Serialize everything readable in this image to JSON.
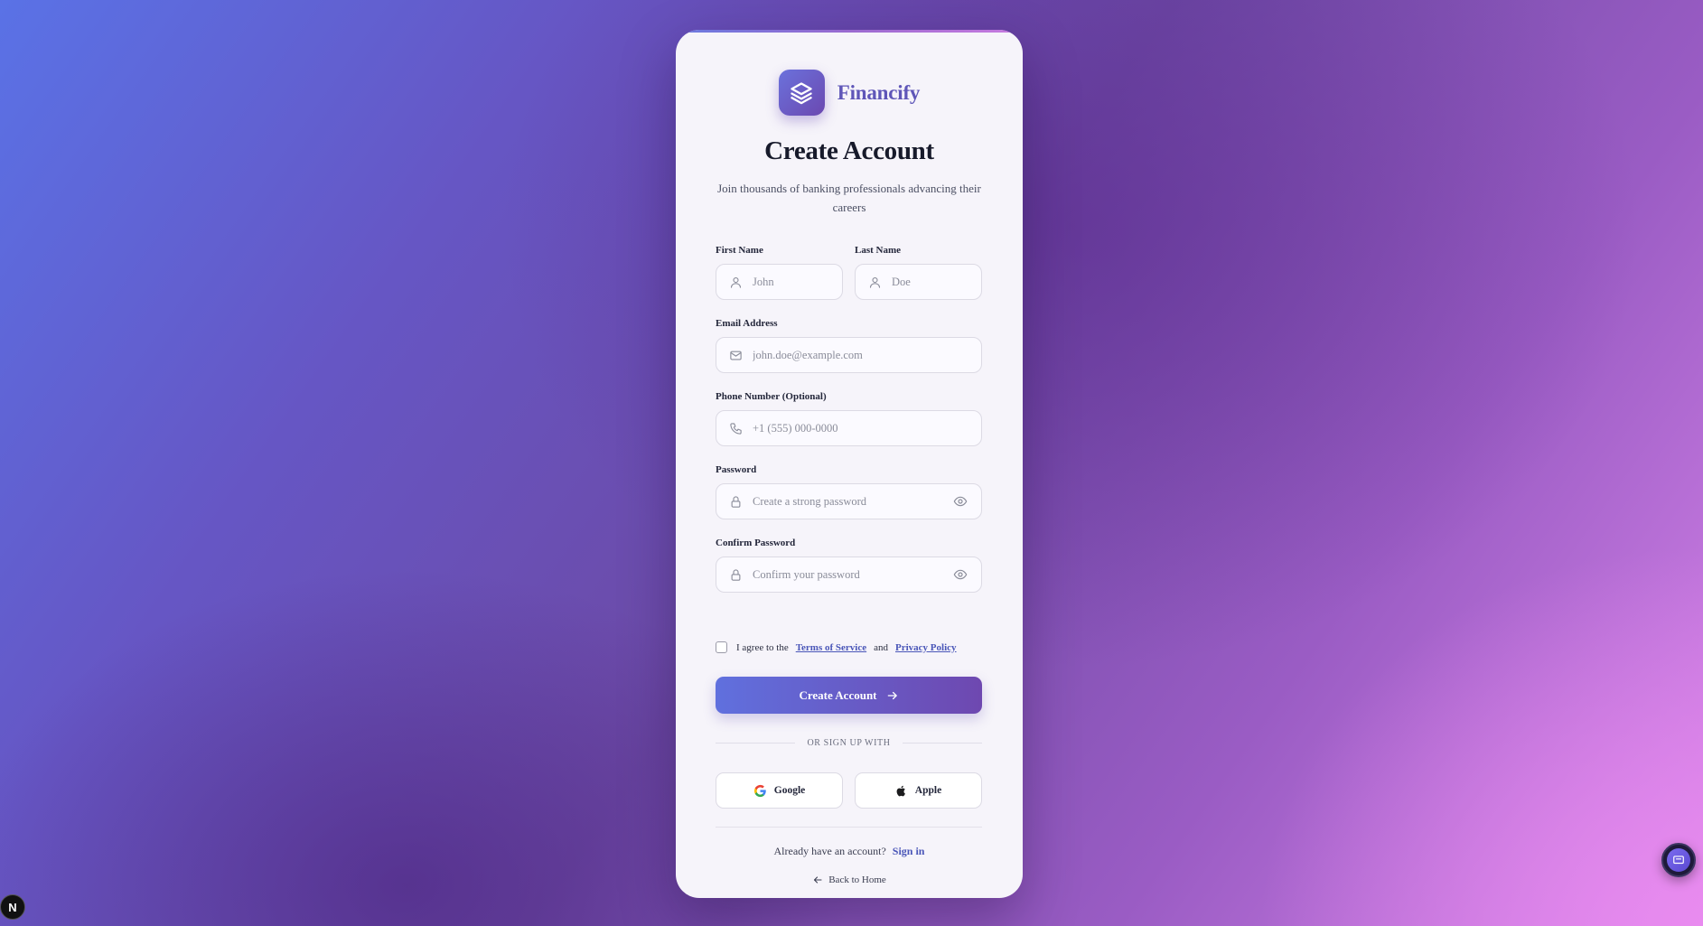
{
  "brand": {
    "name": "Financify",
    "logo_icon": "layers-icon",
    "color": "#5f56b8"
  },
  "header": {
    "title": "Create Account",
    "subtitle": "Join thousands of banking professionals advancing their careers"
  },
  "form": {
    "first_name": {
      "label": "First Name",
      "placeholder": "John",
      "icon": "user-icon"
    },
    "last_name": {
      "label": "Last Name",
      "placeholder": "Doe",
      "icon": "user-icon"
    },
    "email": {
      "label": "Email Address",
      "placeholder": "john.doe@example.com",
      "icon": "mail-icon"
    },
    "phone": {
      "label": "Phone Number (Optional)",
      "placeholder": "+1 (555) 000-0000",
      "icon": "phone-icon"
    },
    "password": {
      "label": "Password",
      "placeholder": "Create a strong password",
      "icon": "lock-icon",
      "toggle_icon": "eye-icon"
    },
    "confirm_password": {
      "label": "Confirm Password",
      "placeholder": "Confirm your password",
      "icon": "lock-icon",
      "toggle_icon": "eye-icon"
    },
    "agree": {
      "prefix": "I agree to the",
      "terms": "Terms of Service",
      "and": "and",
      "privacy": "Privacy Policy",
      "checked": false
    },
    "submit_label": "Create Account",
    "submit_icon": "arrow-right-icon"
  },
  "social": {
    "divider_text": "OR SIGN UP WITH",
    "google_label": "Google",
    "apple_label": "Apple"
  },
  "footer": {
    "already_text": "Already have an account?",
    "signin_label": "Sign in",
    "back_label": "Back to Home"
  },
  "overlay": {
    "next_badge": "N",
    "chat_icon": "chat-widget-icon"
  },
  "colors": {
    "accent": "#4a56b8",
    "button_start": "#6070de",
    "button_end": "#6e48b0"
  }
}
